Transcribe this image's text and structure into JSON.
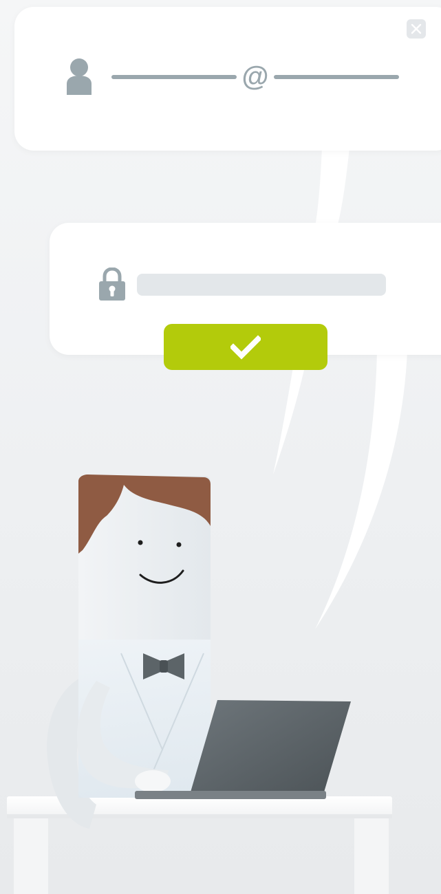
{
  "login": {
    "close_icon": "close-icon",
    "user_icon": "user-icon",
    "at_symbol": "@",
    "lock_icon": "lock-icon",
    "password_value": "",
    "submit_icon": "checkmark-icon"
  },
  "colors": {
    "accent": "#b3cb0b",
    "icon_gray": "#9aa7ad",
    "field_bg": "#e3e7ea",
    "bubble_bg": "#ffffff",
    "background": "#eef0f2"
  },
  "illustration": {
    "subject": "character-at-laptop"
  }
}
